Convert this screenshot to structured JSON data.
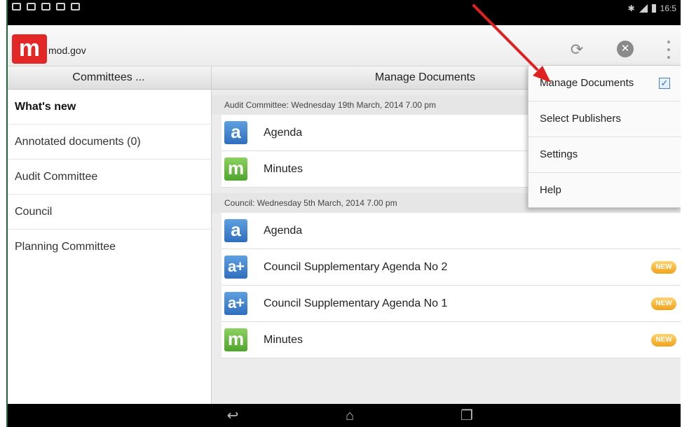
{
  "status_bar": {
    "time": "16:5"
  },
  "app": {
    "logo_letter": "m",
    "name": "mod.gov"
  },
  "action_bar": {
    "refresh_icon": "refresh-icon",
    "close_icon": "close-icon",
    "overflow_icon": "overflow-icon"
  },
  "left_panel": {
    "header": "Committees ...",
    "items": [
      {
        "label": "What's new"
      },
      {
        "label": "Annotated documents (0)"
      },
      {
        "label": "Audit Committee"
      },
      {
        "label": "Council"
      },
      {
        "label": "Planning Committee"
      }
    ]
  },
  "right_panel": {
    "header": "Manage Documents",
    "sections": [
      {
        "title": "Audit Committee: Wednesday 19th March, 2014 7.00 pm",
        "docs": [
          {
            "icon": "a",
            "label": "Agenda",
            "new": false
          },
          {
            "icon": "m",
            "label": "Minutes",
            "new": false
          }
        ]
      },
      {
        "title": "Council: Wednesday 5th March, 2014 7.00 pm",
        "docs": [
          {
            "icon": "a",
            "label": "Agenda",
            "new": false
          },
          {
            "icon": "a+",
            "label": "Council Supplementary Agenda No 2",
            "new": true
          },
          {
            "icon": "a+",
            "label": "Council Supplementary Agenda No 1",
            "new": true
          },
          {
            "icon": "m",
            "label": "Minutes",
            "new": true
          }
        ]
      }
    ],
    "new_badge": "NEW"
  },
  "menu": {
    "items": [
      {
        "label": "Manage Documents",
        "checked": true
      },
      {
        "label": "Select Publishers"
      },
      {
        "label": "Settings"
      },
      {
        "label": "Help"
      }
    ],
    "check_glyph": "✓"
  },
  "colors": {
    "logo": "#e32727",
    "agenda_icon": "#3b7fcf",
    "minutes_icon": "#5cb335",
    "new_badge": "#f0a21c",
    "annotation_arrow": "#e02020"
  }
}
